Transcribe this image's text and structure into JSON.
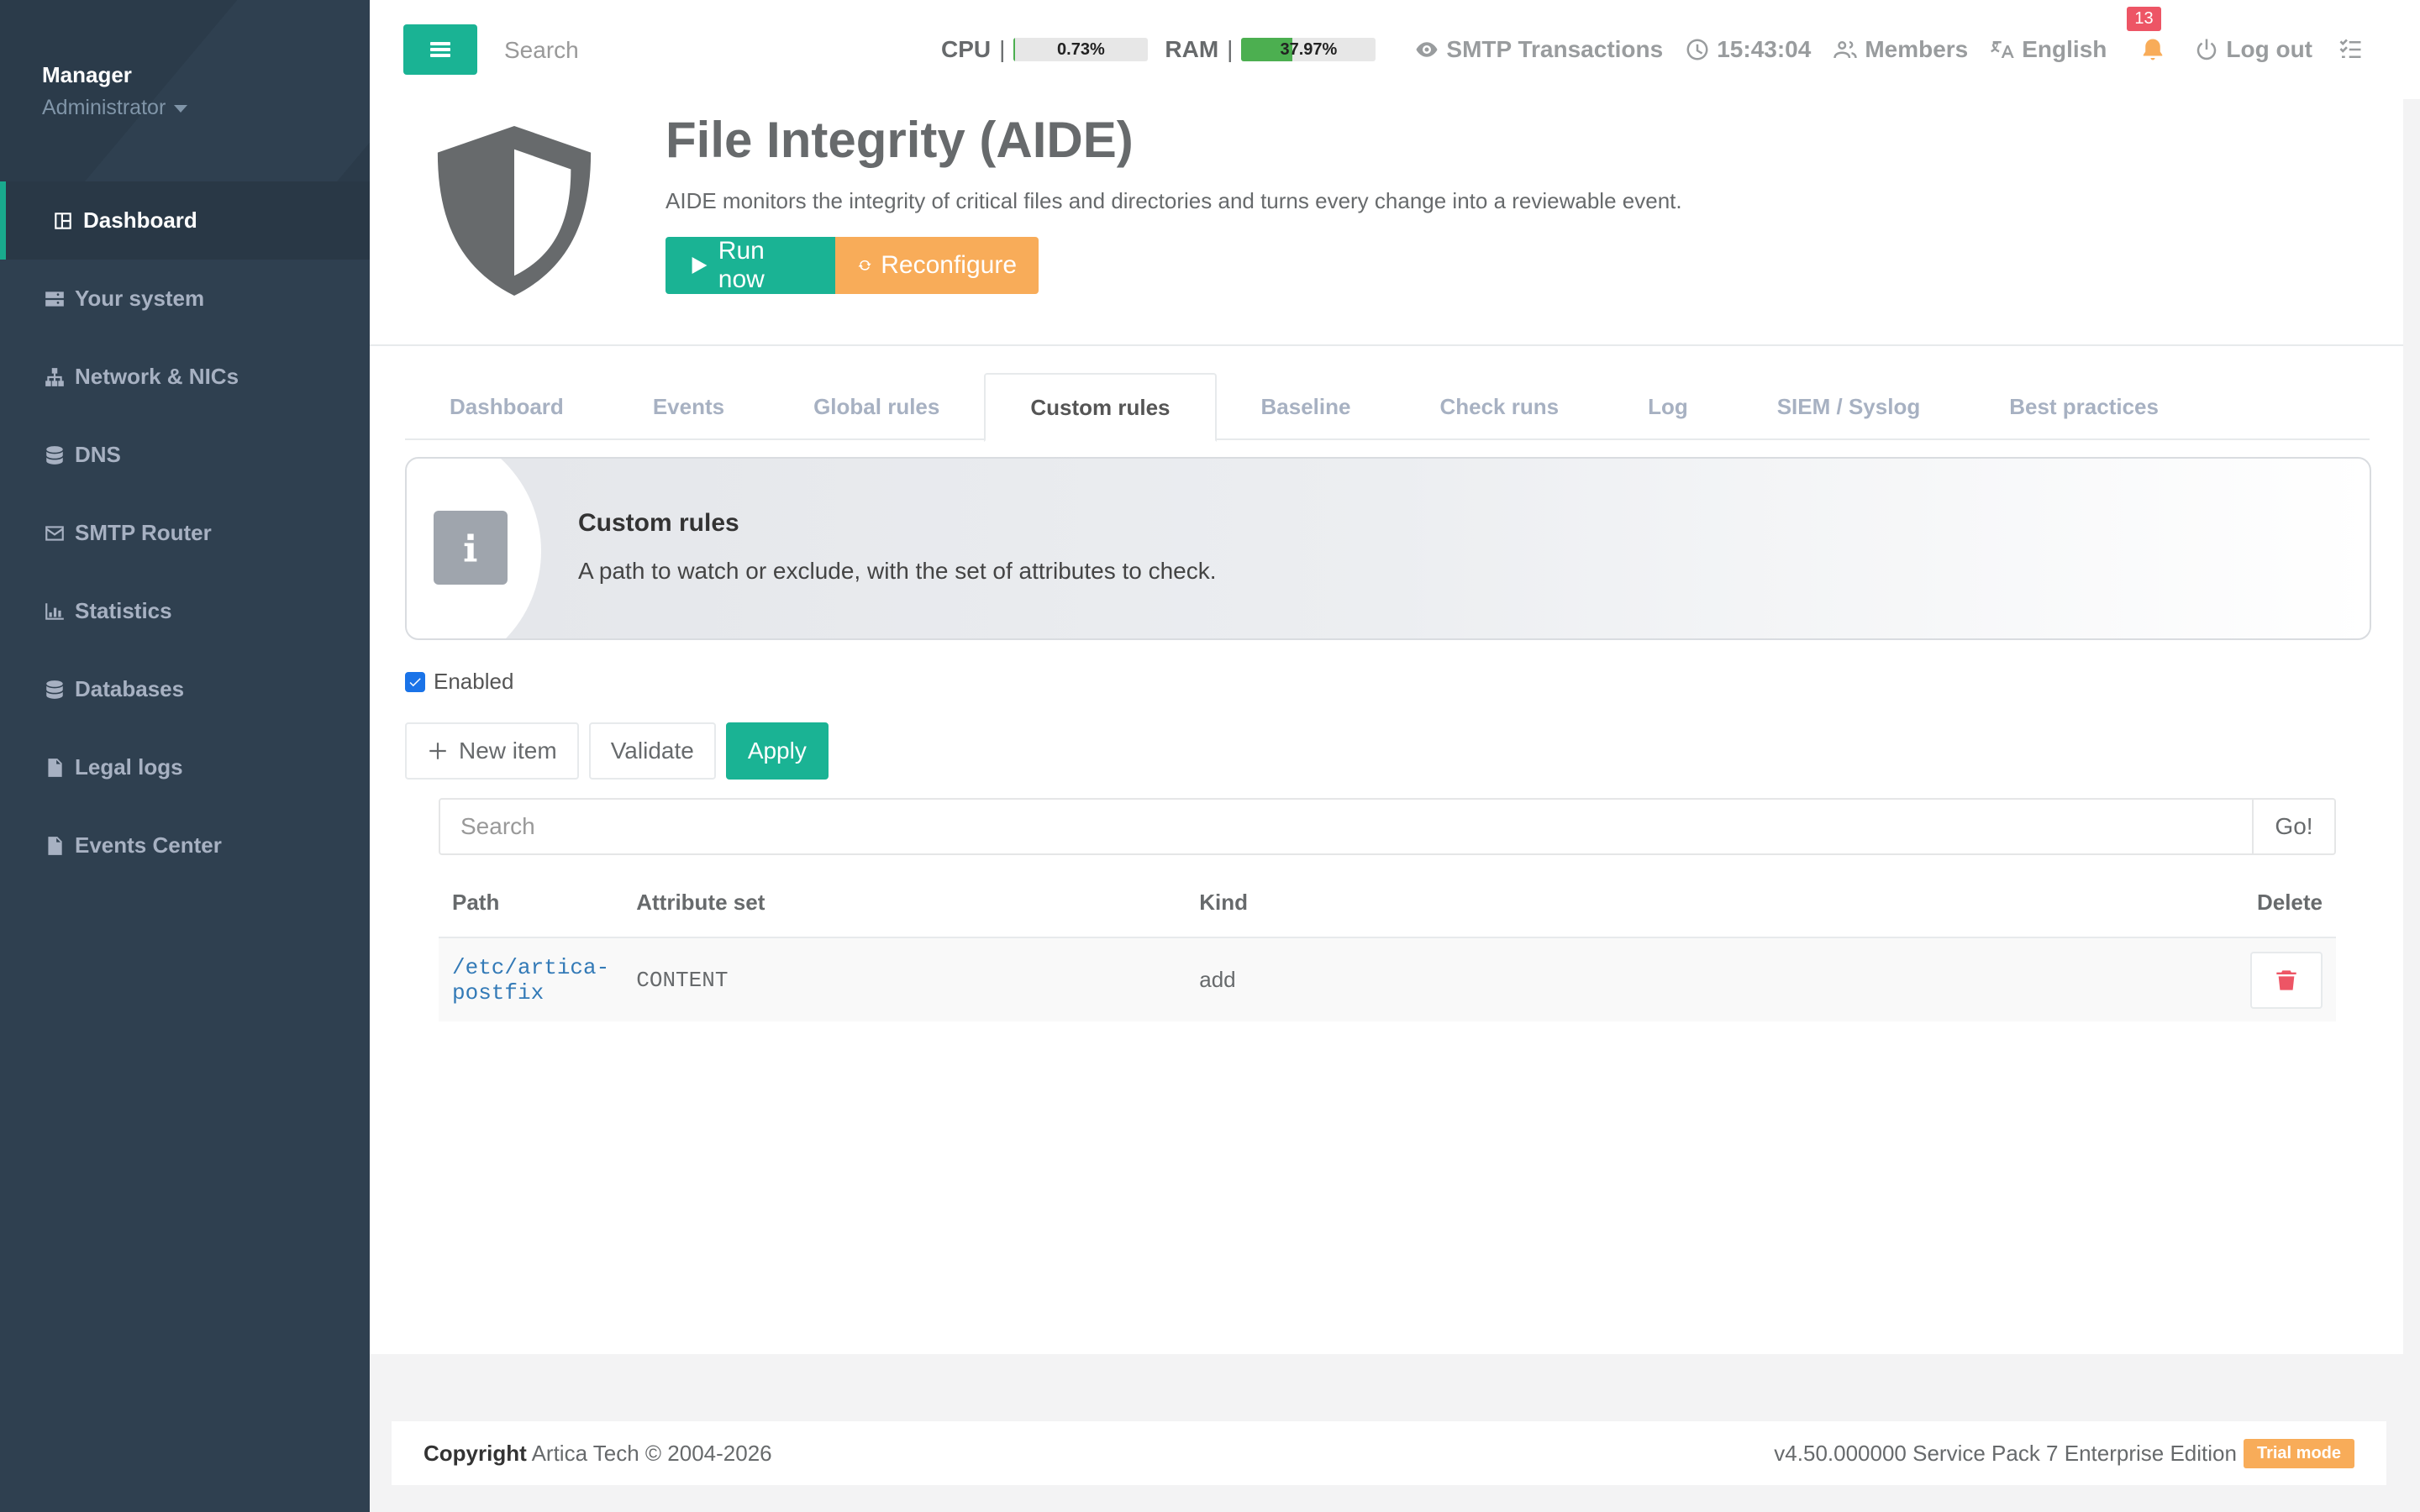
{
  "profile": {
    "name": "Manager",
    "role": "Administrator"
  },
  "sidebar": {
    "items": [
      {
        "label": "Dashboard",
        "icon": "dashboard-icon"
      },
      {
        "label": "Your system",
        "icon": "server-icon"
      },
      {
        "label": "Network & NICs",
        "icon": "sitemap-icon"
      },
      {
        "label": "DNS",
        "icon": "database-icon"
      },
      {
        "label": "SMTP Router",
        "icon": "envelope-icon"
      },
      {
        "label": "Statistics",
        "icon": "chart-icon"
      },
      {
        "label": "Databases",
        "icon": "database-icon"
      },
      {
        "label": "Legal logs",
        "icon": "file-icon"
      },
      {
        "label": "Events Center",
        "icon": "file-icon"
      }
    ]
  },
  "topbar": {
    "search_placeholder": "Search",
    "cpu_label": "CPU",
    "cpu_value": "0.73%",
    "cpu_percent": 0.73,
    "ram_label": "RAM",
    "ram_value": "37.97%",
    "ram_percent": 37.97,
    "smtp": "SMTP Transactions",
    "clock": "15:43:04",
    "members": "Members",
    "language": "English",
    "notifications": "13",
    "logout": "Log out"
  },
  "header": {
    "title": "File Integrity (AIDE)",
    "subtitle": "AIDE monitors the integrity of critical files and directories and turns every change into a reviewable event.",
    "run_label": "Run now",
    "reconfigure_label": "Reconfigure"
  },
  "tabs": [
    "Dashboard",
    "Events",
    "Global rules",
    "Custom rules",
    "Baseline",
    "Check runs",
    "Log",
    "SIEM / Syslog",
    "Best practices"
  ],
  "active_tab": "Custom rules",
  "info": {
    "title": "Custom rules",
    "text": "A path to watch or exclude, with the set of attributes to check."
  },
  "enabled_label": "Enabled",
  "actions": {
    "new_item": "New item",
    "validate": "Validate",
    "apply": "Apply"
  },
  "table_search": {
    "placeholder": "Search",
    "go": "Go!"
  },
  "table": {
    "headers": {
      "path": "Path",
      "attributes": "Attribute set",
      "kind": "Kind",
      "delete": "Delete"
    },
    "rows": [
      {
        "path": "/etc/artica-postfix",
        "attributes": "CONTENT",
        "kind": "add"
      }
    ]
  },
  "footer": {
    "copyright_bold": "Copyright",
    "copyright_text": "Artica Tech © 2004-2026",
    "version": "v4.50.000000 Service Pack 7 Enterprise Edition",
    "trial": "Trial mode"
  },
  "colors": {
    "accent": "#1ab394",
    "warning": "#f8ac59",
    "danger": "#ed5565",
    "sidebar": "#2f4050"
  }
}
